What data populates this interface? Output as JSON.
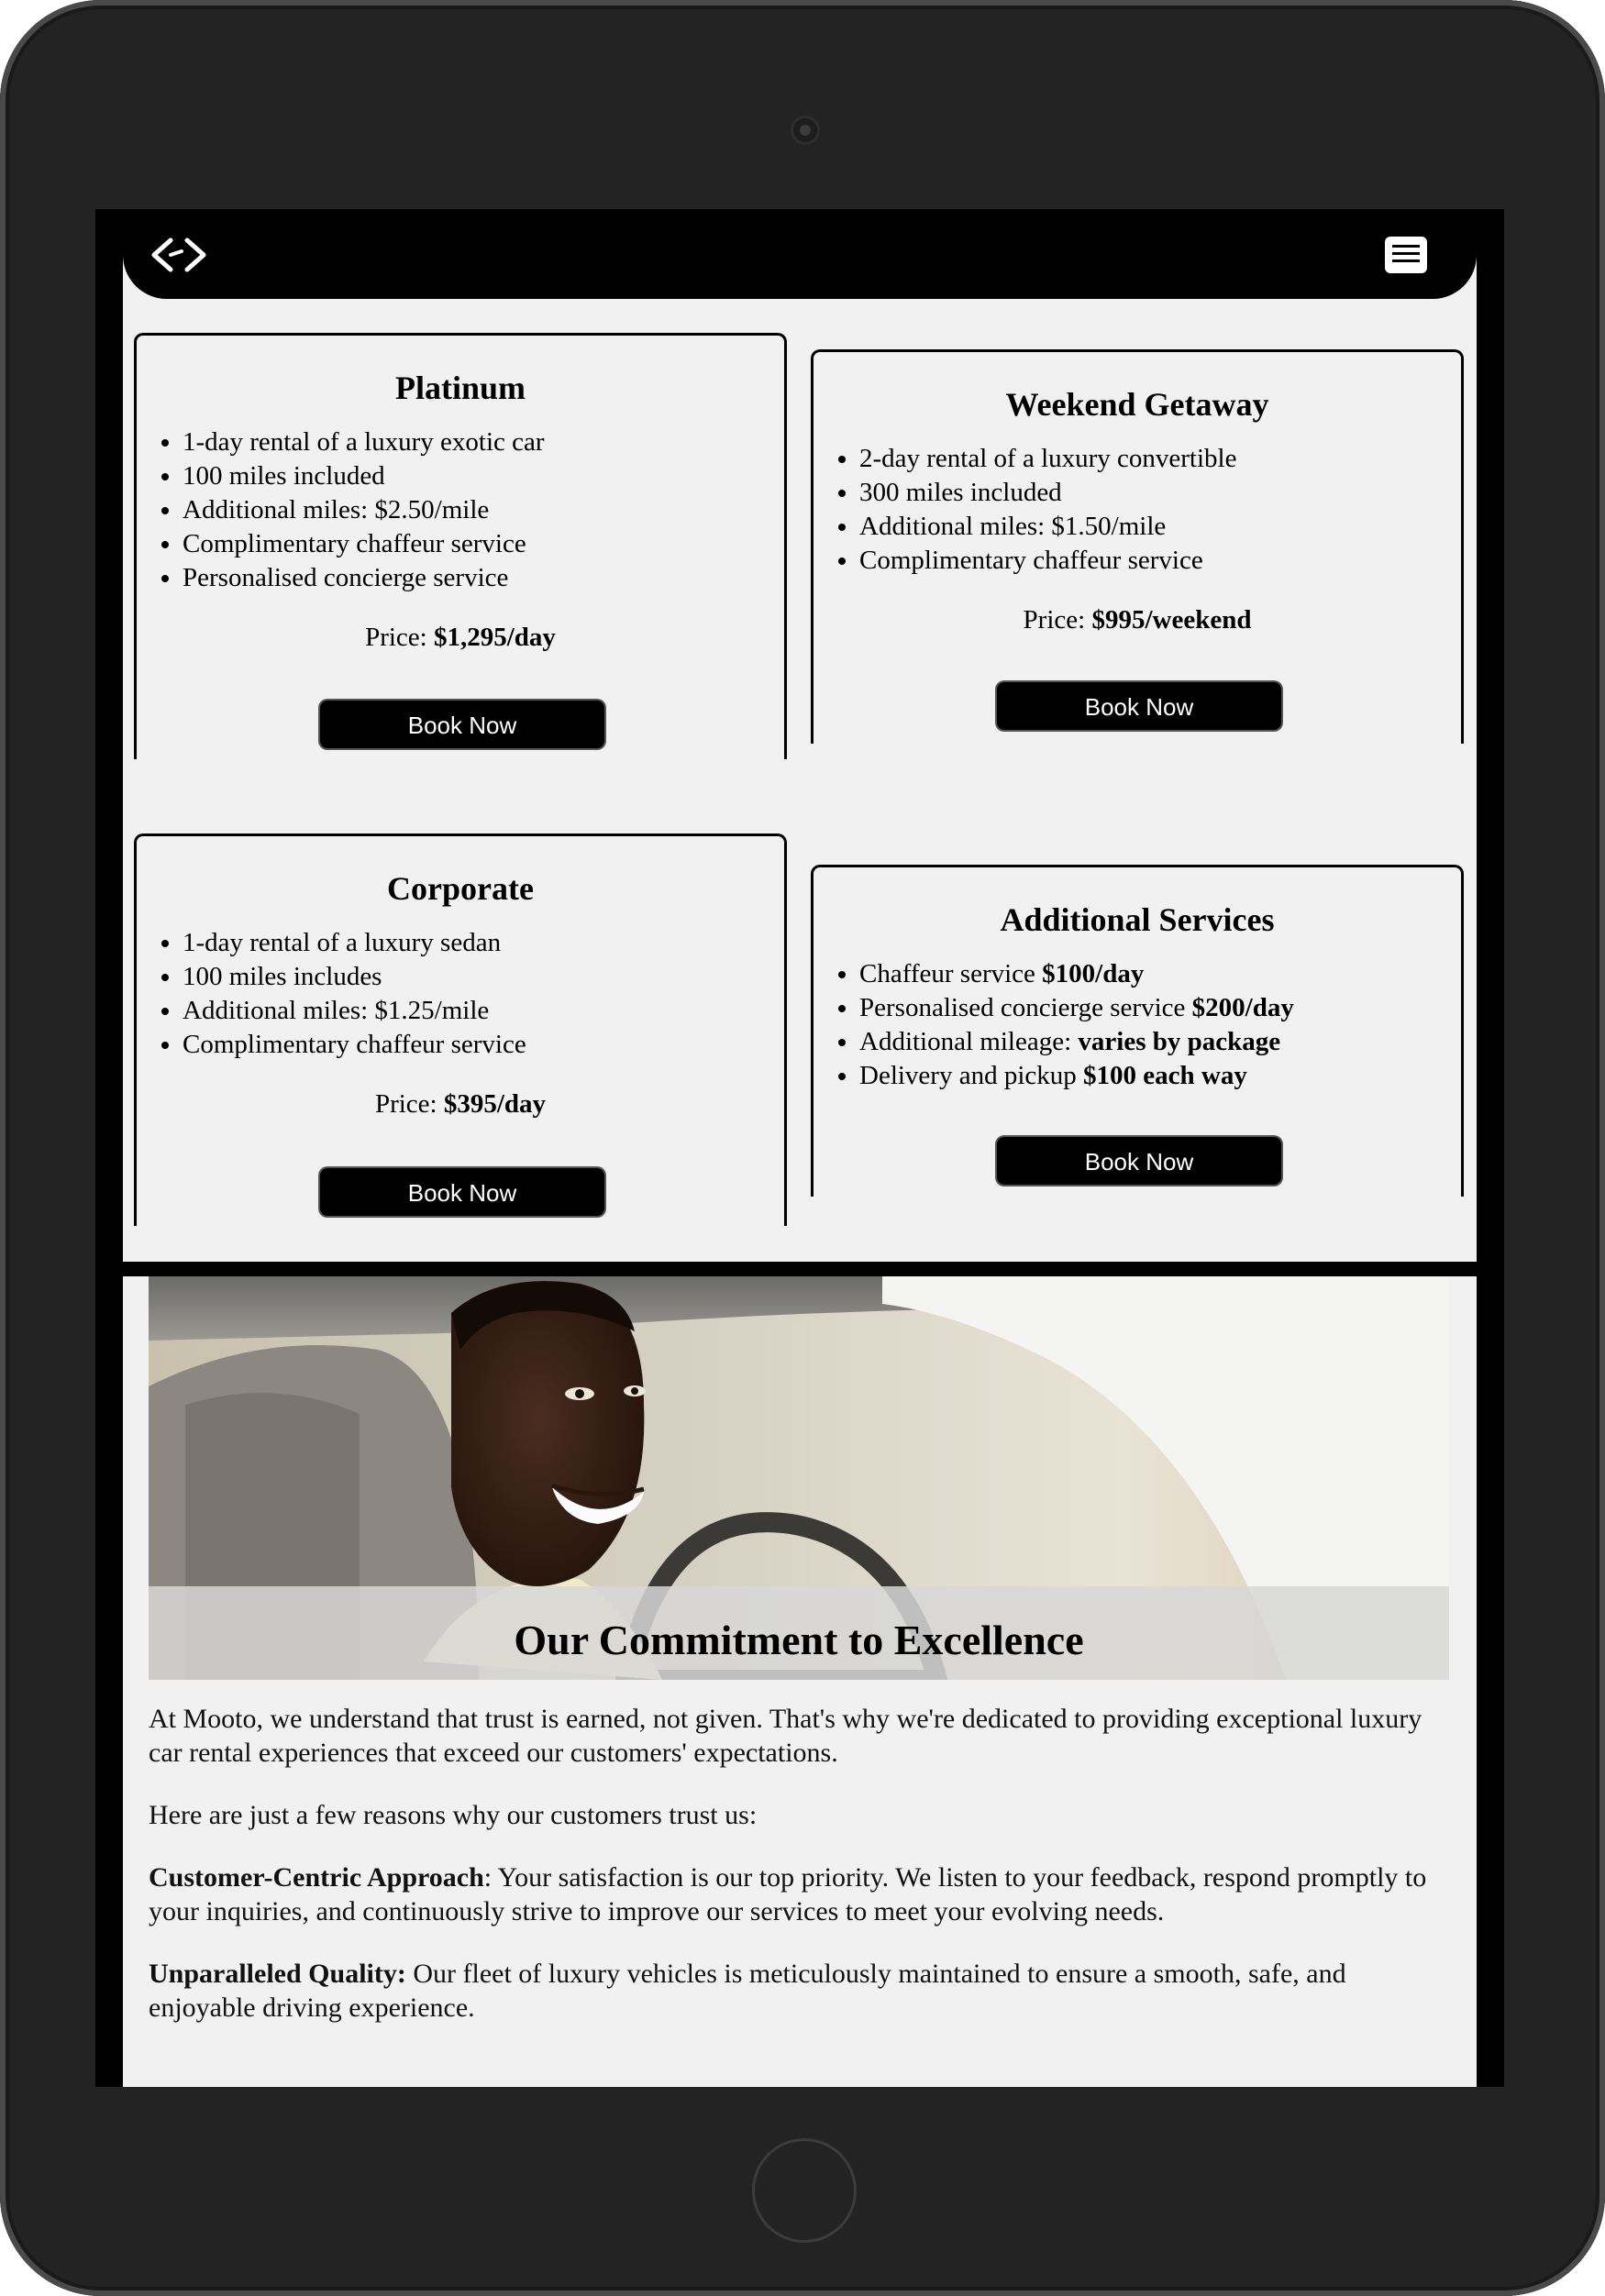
{
  "nav": {
    "logo_icon": "code-brackets-logo-icon",
    "menu_icon": "hamburger-menu-icon"
  },
  "packages": [
    {
      "title": "Platinum",
      "items": [
        {
          "text": "1-day rental of a luxury exotic car"
        },
        {
          "text": "100 miles included"
        },
        {
          "text": "Additional miles: $2.50/mile"
        },
        {
          "text": "Complimentary chaffeur service"
        },
        {
          "text": "Personalised concierge service"
        }
      ],
      "price_label": "Price: ",
      "price_value": "$1,295/day",
      "button": "Book Now"
    },
    {
      "title": "Weekend Getaway",
      "items": [
        {
          "text": "2-day rental of a luxury convertible"
        },
        {
          "text": "300 miles included"
        },
        {
          "text": "Additional miles: $1.50/mile"
        },
        {
          "text": "Complimentary chaffeur service"
        }
      ],
      "price_label": "Price: ",
      "price_value": "$995/weekend",
      "button": "Book Now"
    },
    {
      "title": "Corporate",
      "items": [
        {
          "text": "1-day rental of a luxury sedan"
        },
        {
          "text": "100 miles includes"
        },
        {
          "text": "Additional miles: $1.25/mile"
        },
        {
          "text": "Complimentary chaffeur service"
        }
      ],
      "price_label": "Price: ",
      "price_value": "$395/day",
      "button": "Book Now"
    },
    {
      "title": "Additional Services",
      "items": [
        {
          "text": "Chaffeur service ",
          "bold": "$100/day"
        },
        {
          "text": "Personalised concierge service ",
          "bold": "$200/day"
        },
        {
          "text": "Additional mileage: ",
          "bold": "varies by package"
        },
        {
          "text": "Delivery and pickup ",
          "bold": "$100 each way"
        }
      ],
      "button": "Book Now"
    }
  ],
  "commitment": {
    "title": "Our Commitment to Excellence",
    "intro": "At Mooto, we understand that trust is earned, not given. That's why we're dedicated to providing exceptional luxury car rental experiences that exceed our customers' expectations.",
    "reasons_intro": "Here are just a few reasons why our customers trust us:",
    "reasons": [
      {
        "title": "Customer-Centric Approach",
        "text": ": Your satisfaction is our top priority. We listen to your feedback, respond promptly to your inquiries, and continuously strive to improve our services to meet your evolving needs."
      },
      {
        "title": "Unparalleled Quality:",
        "text": " Our fleet of luxury vehicles is meticulously maintained to ensure a smooth, safe, and enjoyable driving experience."
      }
    ]
  },
  "colors": {
    "page_bg": "#f1f1f1",
    "nav_bg": "#000000",
    "button_bg": "#000000",
    "button_text": "#ffffff"
  }
}
